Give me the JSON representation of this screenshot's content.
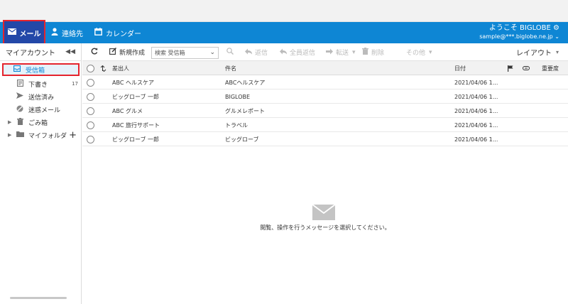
{
  "nav": {
    "mail": "メール",
    "contacts": "連絡先",
    "calendar": "カレンダー",
    "welcome": "ようこそ BIGLOBE",
    "email": "sample@***.biglobe.ne.jp"
  },
  "sidebar": {
    "title": "マイアカウント",
    "items": [
      {
        "label": "受信箱",
        "icon": "inbox-icon"
      },
      {
        "label": "下書き",
        "count": "17",
        "icon": "draft-icon"
      },
      {
        "label": "送信済み",
        "icon": "sent-icon"
      },
      {
        "label": "迷惑メール",
        "icon": "spam-icon"
      },
      {
        "label": "ごみ箱",
        "icon": "trash-icon"
      },
      {
        "label": "マイフォルダ",
        "icon": "folder-icon"
      }
    ]
  },
  "toolbar": {
    "compose": "新規作成",
    "search_placeholder": "検索 受信箱",
    "reply": "返信",
    "reply_all": "全員返信",
    "forward": "転送",
    "delete": "削除",
    "other": "その他",
    "layout": "レイアウト"
  },
  "list": {
    "columns": {
      "from": "差出人",
      "subject": "件名",
      "date": "日付",
      "importance": "重要度"
    },
    "rows": [
      {
        "from": "ABC ヘルスケア",
        "subject": "ABCヘルスケア",
        "date": "2021/04/06 1..."
      },
      {
        "from": "ビッグローブ 一郎",
        "subject": "BIGLOBE",
        "date": "2021/04/06 1..."
      },
      {
        "from": "ABC グルメ",
        "subject": "グルメレポート",
        "date": "2021/04/06 1..."
      },
      {
        "from": "ABC 旅行サポート",
        "subject": "トラベル",
        "date": "2021/04/06 1..."
      },
      {
        "from": "ビッグローブ 一郎",
        "subject": "ビッグローブ",
        "date": "2021/04/06 1..."
      }
    ]
  },
  "empty_message": "閲覧、操作を行うメッセージを選択してください。",
  "colors": {
    "accent": "#0e86d4",
    "highlight": "#e5242d",
    "mail_tab": "#2348a8"
  }
}
